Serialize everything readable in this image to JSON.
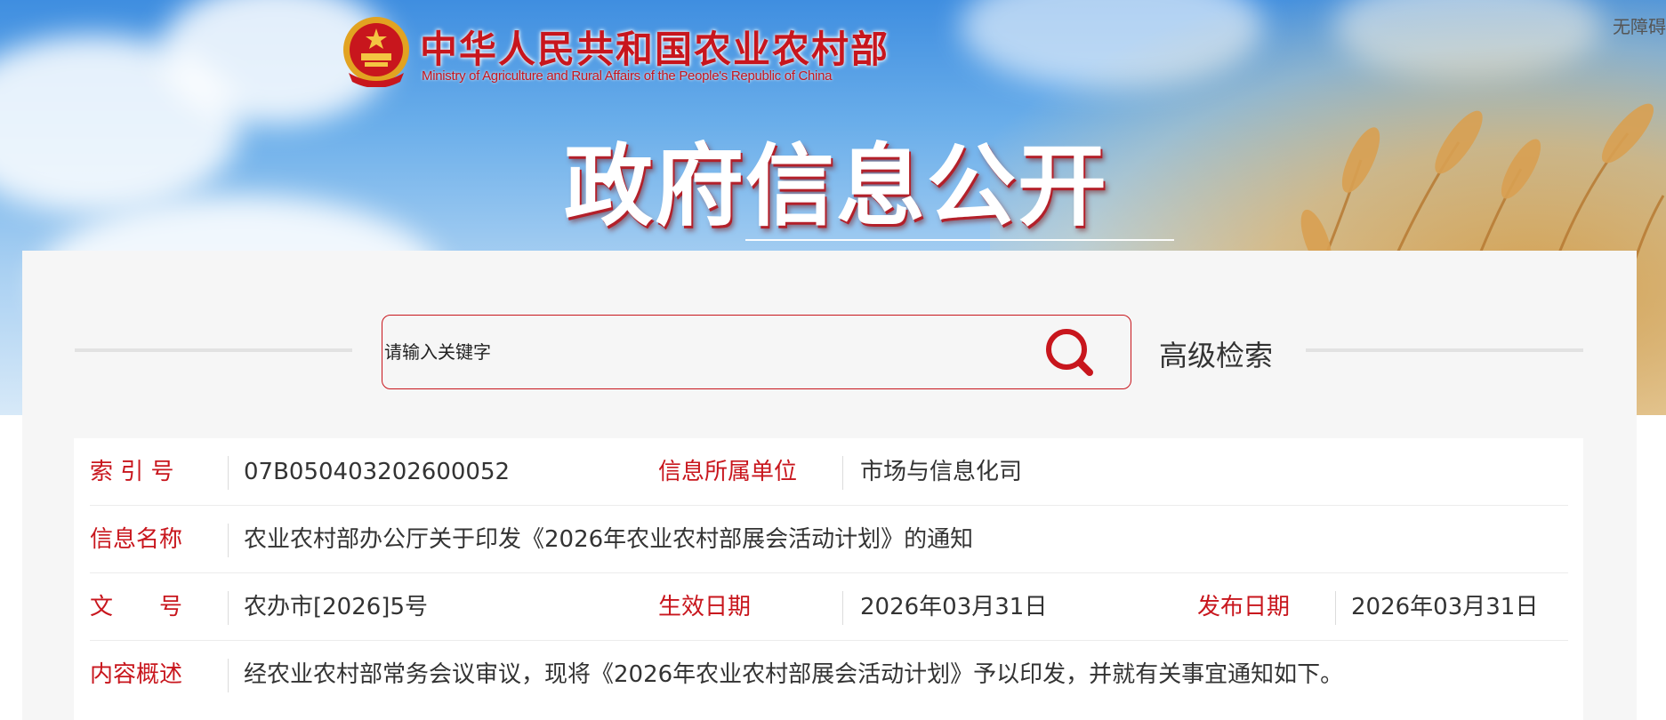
{
  "header": {
    "brand_cn": "中华人民共和国农业农村部",
    "brand_en": "Ministry of Agriculture and Rural Affairs of the People's Republic of China",
    "accessibility_label": "无障碍",
    "page_heading": "政府信息公开"
  },
  "search": {
    "placeholder": "请输入关键字",
    "advanced_label": "高级检索"
  },
  "info": {
    "index_label": "索 引 号",
    "index_value": "07B050403202600052",
    "unit_label": "信息所属单位",
    "unit_value": "市场与信息化司",
    "name_label": "信息名称",
    "name_value": "农业农村部办公厅关于印发《2026年农业农村部展会活动计划》的通知",
    "docno_label": "文　　号",
    "docno_value": "农办市[2026]5号",
    "effective_label": "生效日期",
    "effective_value": "2026年03月31日",
    "publish_label": "发布日期",
    "publish_value": "2026年03月31日",
    "summary_label": "内容概述",
    "summary_value": "经农业农村部常务会议审议，现将《2026年农业农村部展会活动计划》予以印发，并就有关事宜通知如下。"
  },
  "colors": {
    "brand_red": "#c8161d",
    "panel_bg": "#f6f6f6",
    "sky_blue": "#5aa2e6"
  },
  "icons": [
    "national-emblem-icon",
    "search-icon"
  ]
}
